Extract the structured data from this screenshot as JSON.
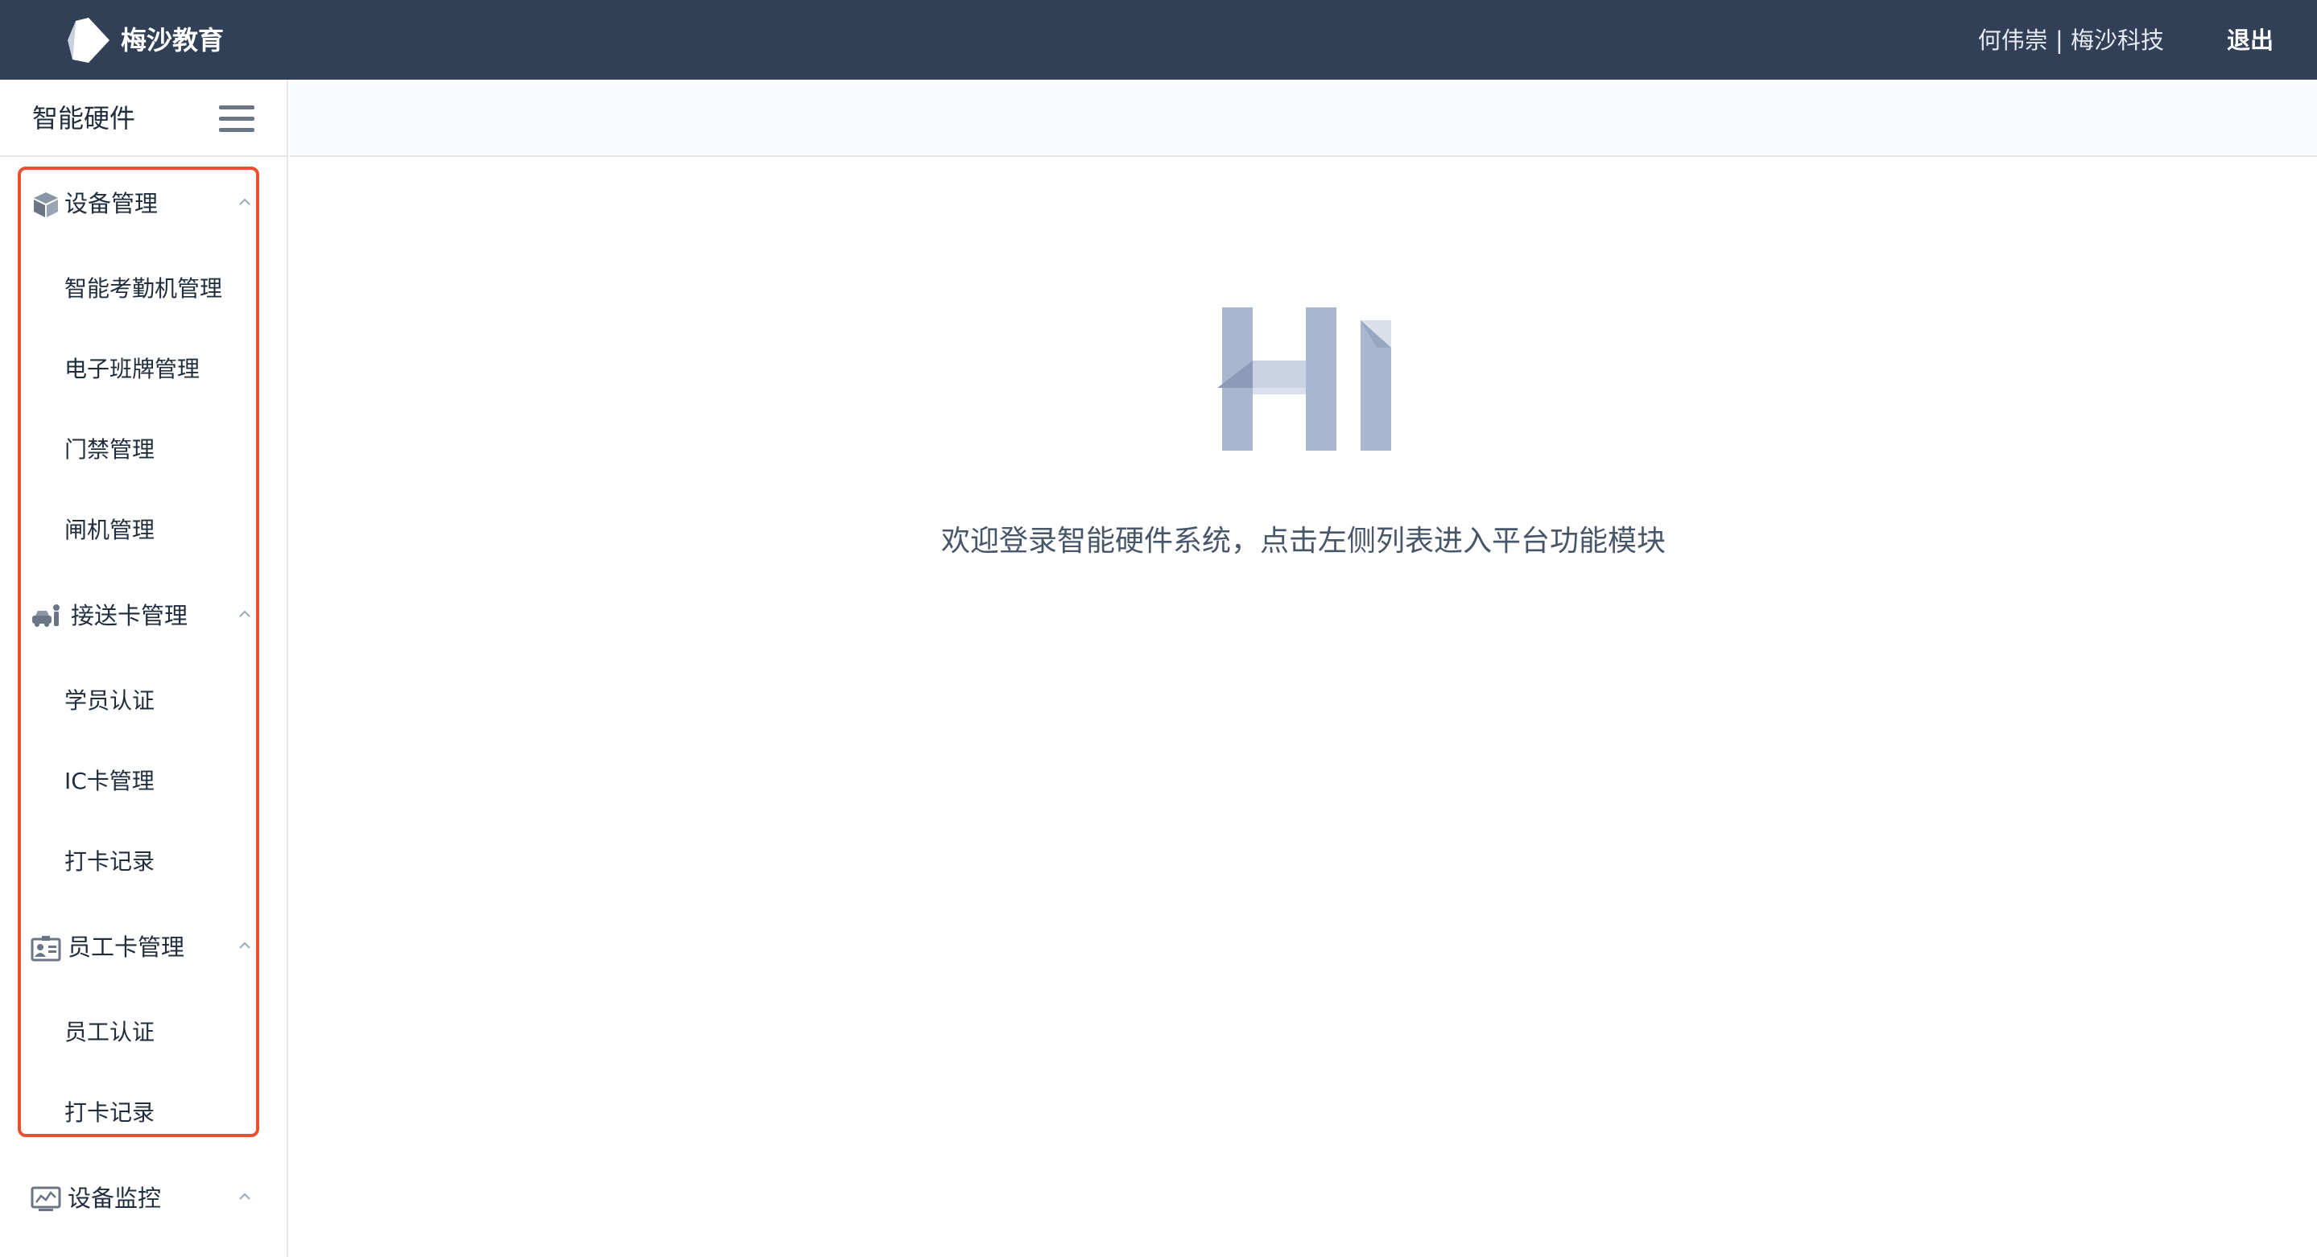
{
  "header": {
    "brand": "梅沙教育",
    "user": "何伟崇 | 梅沙科技",
    "logout_label": "退出",
    "colors": {
      "background": "#324057"
    }
  },
  "sidebar": {
    "title": "智能硬件",
    "groups": [
      {
        "label": "设备管理",
        "icon": "cube-icon",
        "items": [
          "智能考勤机管理",
          "电子班牌管理",
          "门禁管理",
          "闸机管理"
        ]
      },
      {
        "label": "接送卡管理",
        "icon": "car-person-icon",
        "items": [
          "学员认证",
          "IC卡管理",
          "打卡记录"
        ]
      },
      {
        "label": "员工卡管理",
        "icon": "id-card-icon",
        "items": [
          "员工认证",
          "打卡记录"
        ]
      },
      {
        "label": "设备监控",
        "icon": "monitor-chart-icon",
        "items": []
      }
    ],
    "highlight_color": "#e8502f"
  },
  "main": {
    "hero_text": "Hi",
    "welcome": "欢迎登录智能硬件系统，点击左侧列表进入平台功能模块",
    "hero_color": "#a8b7cf"
  }
}
